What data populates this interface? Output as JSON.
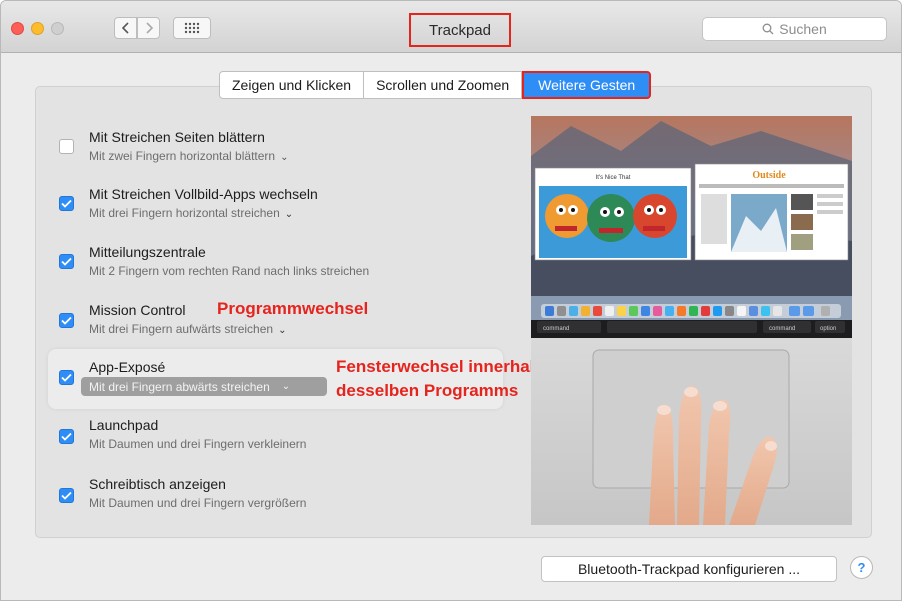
{
  "window": {
    "title": "Trackpad"
  },
  "search": {
    "placeholder": "Suchen",
    "icon": "search-icon"
  },
  "tabs": [
    {
      "label": "Zeigen und Klicken",
      "active": false
    },
    {
      "label": "Scrollen und Zoomen",
      "active": false
    },
    {
      "label": "Weitere Gesten",
      "active": true
    }
  ],
  "gestures": [
    {
      "title": "Mit Streichen Seiten blättern",
      "subtitle": "Mit zwei Fingern horizontal blättern",
      "checked": false,
      "has_menu": true
    },
    {
      "title": "Mit Streichen Vollbild-Apps wechseln",
      "subtitle": "Mit drei Fingern horizontal streichen",
      "checked": true,
      "has_menu": true
    },
    {
      "title": "Mitteilungszentrale",
      "subtitle": "Mit 2 Fingern vom rechten Rand nach links streichen",
      "checked": true,
      "has_menu": false
    },
    {
      "title": "Mission Control",
      "subtitle": "Mit drei Fingern aufwärts streichen",
      "checked": true,
      "has_menu": true
    },
    {
      "title": "App-Exposé",
      "subtitle": "Mit drei Fingern abwärts streichen",
      "checked": true,
      "has_menu": true,
      "selected": true
    },
    {
      "title": "Launchpad",
      "subtitle": "Mit Daumen und drei Fingern verkleinern",
      "checked": true,
      "has_menu": false
    },
    {
      "title": "Schreibtisch anzeigen",
      "subtitle": "Mit Daumen und drei Fingern vergrößern",
      "checked": true,
      "has_menu": false
    }
  ],
  "annotations": {
    "mission_control": "Programmwechsel",
    "app_expose_line1": "Fensterwechsel innerhalb",
    "app_expose_line2": "desselben Programms"
  },
  "preview": {
    "screen_left_text": "It's Nice That",
    "screen_right_text": "Outside",
    "key_left": "command",
    "key_right1": "command",
    "key_right2": "option"
  },
  "footer": {
    "bluetooth_button": "Bluetooth-Trackpad konfigurieren ...",
    "help_label": "?"
  },
  "colors": {
    "accent": "#2f8ef5",
    "annotation_red": "#e6241e",
    "window_bg": "#ececec"
  }
}
